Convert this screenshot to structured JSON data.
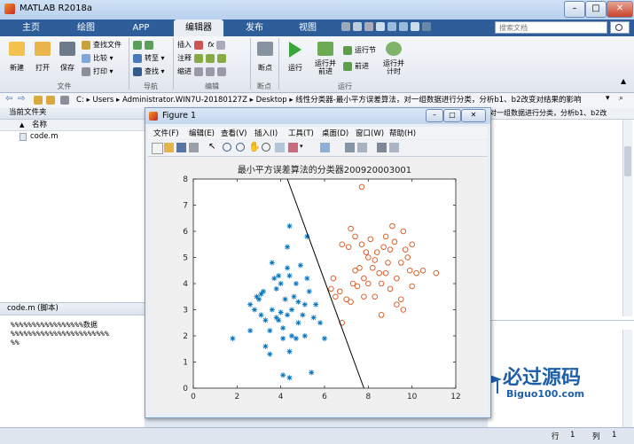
{
  "window": {
    "title": "MATLAB R2018a"
  },
  "tabs": [
    {
      "label": "主页"
    },
    {
      "label": "绘图"
    },
    {
      "label": "APP"
    },
    {
      "label": "编辑器",
      "active": true
    },
    {
      "label": "发布"
    },
    {
      "label": "视图"
    }
  ],
  "search": {
    "placeholder": "搜索文档"
  },
  "ribbon": {
    "file": {
      "new": "新建",
      "open": "打开",
      "save": "保存",
      "find_files": "查找文件",
      "compare": "比较",
      "print": "打印",
      "group": "文件"
    },
    "navigate": {
      "goto": "转至",
      "find": "查找",
      "group": "导航"
    },
    "edit": {
      "insert": "插入",
      "comment": "注释",
      "indent": "缩进",
      "fx": "fx",
      "group": "编辑"
    },
    "breakpoints": {
      "breakpoint": "断点",
      "group": "断点"
    },
    "run": {
      "run": "运行",
      "run_advance": "运行并\n前进",
      "run_section": "运行节",
      "advance": "前进",
      "run_time": "运行并\n计时",
      "group": "运行"
    }
  },
  "address": {
    "path": [
      "C:",
      "Users",
      "Administrator.WIN7U-20180127Z",
      "Desktop",
      "线性分类器-最小平方误差算法，对一组数据进行分类，分析b1、b2改变对结果的影响"
    ]
  },
  "left_panel": {
    "header": "当前文件夹",
    "col_name": "名称",
    "col_sort": "▲",
    "files": [
      "code.m"
    ]
  },
  "editor_panel": {
    "title": "code.m  (脚本)",
    "lines": [
      "%%%%%%%%%%%%%%%%%数据",
      "%%%%%%%%%%%%%%%%%%%%%%%",
      "%%"
    ]
  },
  "right_panel": {
    "text": "对一组数据进行分类，分析b1、b2改"
  },
  "status": {
    "row_label": "行",
    "row": "1",
    "col_label": "列",
    "col": "1"
  },
  "watermark": {
    "text": "必过源码",
    "sub": "Biguo100.com"
  },
  "figure": {
    "title": "Figure 1",
    "menu": [
      "文件(F)",
      "编辑(E)",
      "查看(V)",
      "插入(I)",
      "工具(T)",
      "桌面(D)",
      "窗口(W)",
      "帮助(H)"
    ]
  },
  "chart_data": {
    "type": "scatter",
    "title": "最小平方误差算法的分类器200920003001",
    "xlim": [
      0,
      12
    ],
    "ylim": [
      0,
      8
    ],
    "xticks": [
      0,
      2,
      4,
      6,
      8,
      10,
      12
    ],
    "yticks": [
      0,
      1,
      2,
      3,
      4,
      5,
      6,
      7,
      8
    ],
    "colors": {
      "class1": "#0072bd",
      "class2": "#d95319",
      "line": "#000000"
    },
    "series": [
      {
        "marker": "star",
        "color": "#0072bd",
        "points": [
          [
            1.8,
            1.9
          ],
          [
            2.6,
            2.2
          ],
          [
            2.8,
            3.0
          ],
          [
            2.9,
            3.5
          ],
          [
            3.0,
            3.4
          ],
          [
            3.1,
            3.6
          ],
          [
            3.2,
            3.7
          ],
          [
            3.1,
            2.8
          ],
          [
            3.3,
            2.6
          ],
          [
            3.3,
            1.6
          ],
          [
            3.5,
            1.3
          ],
          [
            3.5,
            2.2
          ],
          [
            3.6,
            3.0
          ],
          [
            3.7,
            4.2
          ],
          [
            3.8,
            3.8
          ],
          [
            3.8,
            2.7
          ],
          [
            3.9,
            2.6
          ],
          [
            4.0,
            4.0
          ],
          [
            4.0,
            2.9
          ],
          [
            4.1,
            1.9
          ],
          [
            4.1,
            2.3
          ],
          [
            4.2,
            3.4
          ],
          [
            4.3,
            4.6
          ],
          [
            4.3,
            2.8
          ],
          [
            4.4,
            4.3
          ],
          [
            4.4,
            1.4
          ],
          [
            4.4,
            6.2
          ],
          [
            4.5,
            3.0
          ],
          [
            4.5,
            2.0
          ],
          [
            4.6,
            3.5
          ],
          [
            4.7,
            4.0
          ],
          [
            4.8,
            3.3
          ],
          [
            4.8,
            2.5
          ],
          [
            4.9,
            4.7
          ],
          [
            5.0,
            2.8
          ],
          [
            5.1,
            3.2
          ],
          [
            5.1,
            2.0
          ],
          [
            5.2,
            4.2
          ],
          [
            5.3,
            3.7
          ],
          [
            5.5,
            2.7
          ],
          [
            5.6,
            3.2
          ],
          [
            5.8,
            2.5
          ],
          [
            6.0,
            1.9
          ],
          [
            5.2,
            5.8
          ],
          [
            4.3,
            5.4
          ],
          [
            4.1,
            0.5
          ],
          [
            4.4,
            0.4
          ],
          [
            5.4,
            0.6
          ],
          [
            4.7,
            1.9
          ],
          [
            3.9,
            4.3
          ],
          [
            3.6,
            4.8
          ],
          [
            2.6,
            3.2
          ]
        ]
      },
      {
        "marker": "circle",
        "color": "#d95319",
        "points": [
          [
            6.3,
            3.8
          ],
          [
            6.5,
            3.5
          ],
          [
            6.7,
            3.7
          ],
          [
            6.8,
            2.5
          ],
          [
            7.0,
            3.4
          ],
          [
            7.1,
            5.4
          ],
          [
            7.2,
            3.3
          ],
          [
            7.3,
            4.0
          ],
          [
            7.4,
            4.5
          ],
          [
            7.4,
            5.8
          ],
          [
            7.5,
            3.9
          ],
          [
            7.6,
            4.6
          ],
          [
            7.7,
            5.5
          ],
          [
            7.8,
            3.5
          ],
          [
            7.8,
            4.2
          ],
          [
            7.9,
            5.2
          ],
          [
            8.0,
            5.0
          ],
          [
            8.0,
            4.0
          ],
          [
            8.1,
            5.7
          ],
          [
            8.2,
            4.6
          ],
          [
            8.3,
            3.5
          ],
          [
            8.3,
            4.9
          ],
          [
            8.4,
            5.2
          ],
          [
            8.5,
            4.4
          ],
          [
            8.6,
            4.0
          ],
          [
            8.6,
            2.8
          ],
          [
            8.7,
            5.4
          ],
          [
            8.8,
            5.8
          ],
          [
            8.9,
            4.8
          ],
          [
            9.0,
            3.8
          ],
          [
            9.0,
            5.3
          ],
          [
            9.1,
            6.2
          ],
          [
            9.2,
            5.6
          ],
          [
            9.3,
            4.2
          ],
          [
            9.3,
            3.2
          ],
          [
            9.5,
            3.4
          ],
          [
            9.5,
            4.8
          ],
          [
            9.6,
            6.0
          ],
          [
            9.7,
            5.3
          ],
          [
            9.8,
            5.0
          ],
          [
            9.9,
            4.5
          ],
          [
            10.0,
            5.5
          ],
          [
            10.2,
            4.4
          ],
          [
            10.5,
            4.5
          ],
          [
            11.1,
            4.4
          ],
          [
            9.6,
            3.0
          ],
          [
            10.0,
            3.9
          ],
          [
            7.7,
            7.7
          ],
          [
            6.8,
            5.5
          ],
          [
            6.4,
            4.2
          ],
          [
            7.2,
            6.1
          ],
          [
            8.8,
            4.4
          ]
        ]
      }
    ],
    "decision_line": [
      [
        4.3,
        8
      ],
      [
        7.8,
        0
      ]
    ]
  }
}
